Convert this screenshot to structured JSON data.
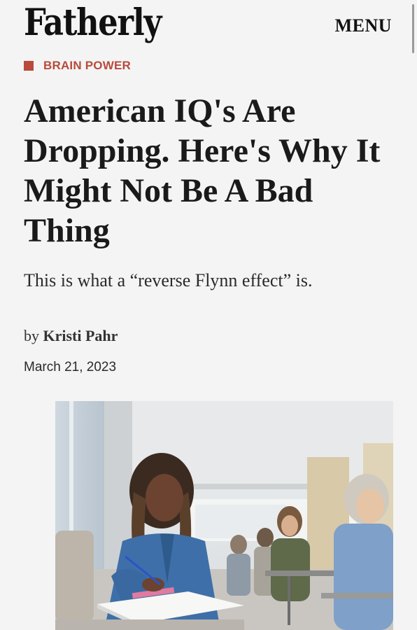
{
  "header": {
    "logo_text": "Fatherly",
    "menu_label": "MENU"
  },
  "article": {
    "category": "BRAIN POWER",
    "headline": "American IQ's Are Dropping. Here's Why It Might Not Be A Bad Thing",
    "dek": "This is what a “reverse Flynn effect” is.",
    "byline_prefix": "by",
    "author": "Kristi Pahr",
    "date": "March 21, 2023"
  },
  "colors": {
    "accent": "#b94a3c",
    "background": "#f4f4f4",
    "text": "#1c1c1c"
  },
  "icons": {
    "category_marker": "red-square-icon"
  }
}
